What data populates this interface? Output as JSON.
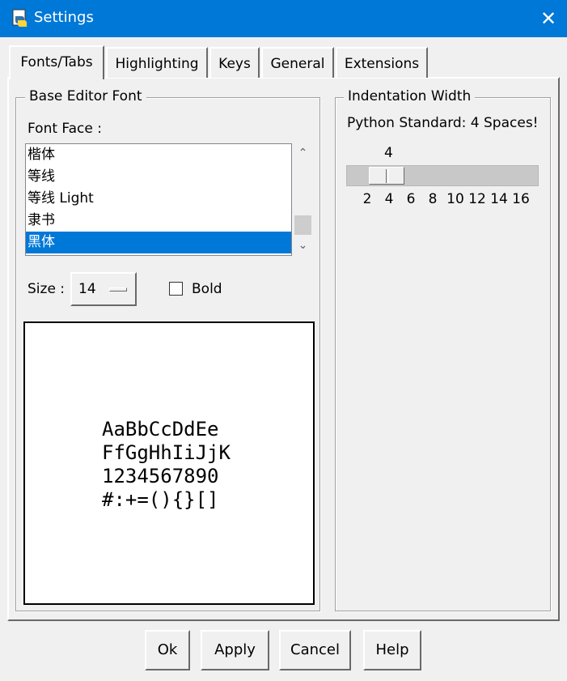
{
  "window": {
    "title": "Settings",
    "close_glyph": "✕"
  },
  "tabs": [
    {
      "label": "Fonts/Tabs",
      "active": true
    },
    {
      "label": "Highlighting",
      "active": false
    },
    {
      "label": "Keys",
      "active": false
    },
    {
      "label": "General",
      "active": false
    },
    {
      "label": "Extensions",
      "active": false
    }
  ],
  "font_group": {
    "title": "Base Editor Font",
    "font_face_label": "Font Face :",
    "fonts": [
      "楷体",
      "等线",
      "等线 Light",
      "隶书",
      "黑体"
    ],
    "selected_font": "黑体",
    "size_label": "Size :",
    "size_value": "14",
    "bold_label": "Bold",
    "bold_checked": false,
    "sample_lines": [
      "AaBbCcDdEe",
      "FfGgHhIiJjK",
      "1234567890",
      "#:+=(){}[]"
    ]
  },
  "indent_group": {
    "title": "Indentation Width",
    "note": "Python Standard: 4 Spaces!",
    "value": "4",
    "min": 2,
    "max": 16,
    "ticks": [
      "2",
      "4",
      "6",
      "8",
      "10",
      "12",
      "14",
      "16"
    ]
  },
  "buttons": {
    "ok": "Ok",
    "apply": "Apply",
    "cancel": "Cancel",
    "help": "Help"
  },
  "colors": {
    "titlebar": "#0078d7",
    "selection": "#0078d7",
    "background": "#f0f0f0"
  }
}
